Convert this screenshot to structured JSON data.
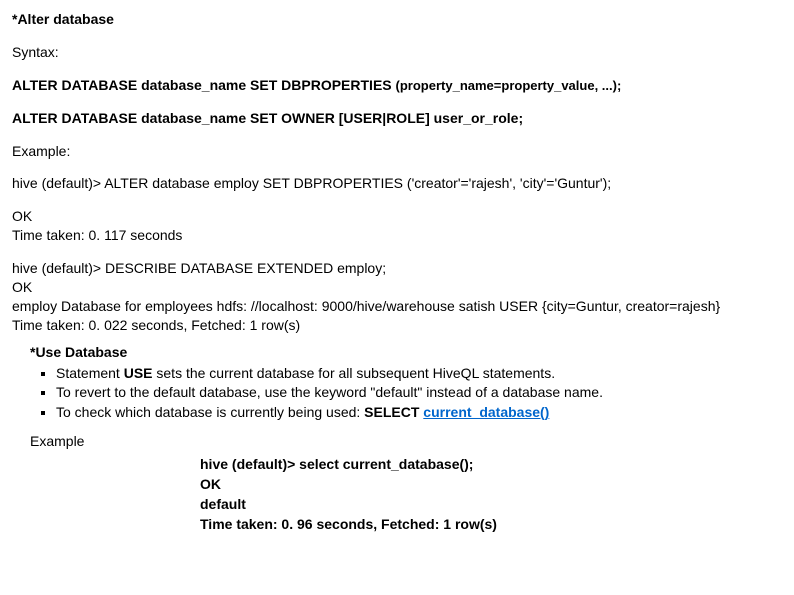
{
  "heading1": "*Alter database",
  "syntaxLabel": "Syntax:",
  "syntax1_a": "ALTER DATABASE database_name SET DBPROPERTIES ",
  "syntax1_b": "(property_name=property_value, ...);",
  "syntax2": "ALTER DATABASE database_name SET OWNER [USER|ROLE] user_or_role;",
  "exampleLabel": "Example:",
  "cmd1": "hive (default)> ALTER database employ SET DBPROPERTIES ('creator'='rajesh', 'city'='Guntur');",
  "out1_line1": "OK",
  "out1_line2": "Time taken: 0. 117 seconds",
  "cmd2": "hive (default)> DESCRIBE DATABASE EXTENDED employ;",
  "out2_line1": "OK",
  "out2_line2": "employ    Database for employees hdfs: //localhost: 9000/hive/warehouse   satish  USER {city=Guntur, creator=rajesh}",
  "out2_line3": "Time taken: 0. 022 seconds, Fetched: 1 row(s)",
  "heading2": "*Use Database",
  "bullets": {
    "b1_a": "Statement ",
    "b1_b": "USE",
    "b1_c": " sets the current database for all subsequent HiveQL statements.",
    "b2": "To revert to the default database, use the keyword \"default\" instead of a database name.",
    "b3_a": "To check which database is currently being used: ",
    "b3_b": "SELECT ",
    "b3_link": "current_database()"
  },
  "exampleLabel2": "Example",
  "ex2": {
    "l1": "hive (default)> select current_database();",
    "l2": "OK",
    "l3": "default",
    "l4": "Time taken: 0. 96 seconds, Fetched: 1 row(s)"
  }
}
